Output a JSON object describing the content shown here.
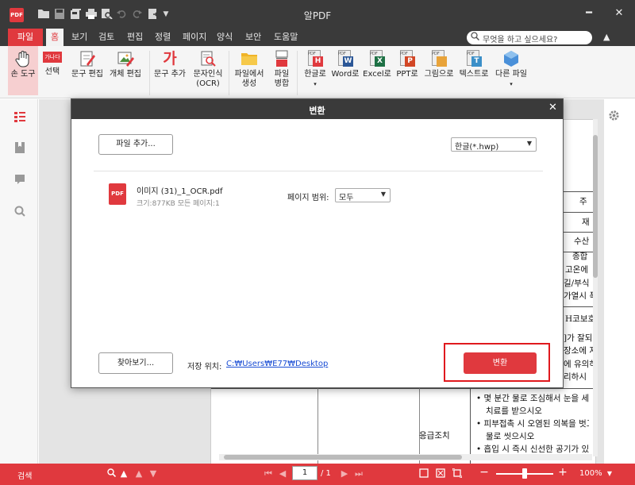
{
  "window": {
    "title": "알PDF",
    "app_logo": "PDF",
    "close": "✕",
    "minimize": "━"
  },
  "quick_access": [
    "folder-icon",
    "save-icon",
    "save-all-icon",
    "print-icon",
    "preview-icon",
    "undo-icon",
    "redo-icon",
    "export-icon",
    "dropdown-icon"
  ],
  "menu": {
    "file": "파일",
    "items": [
      "홈",
      "보기",
      "검토",
      "편집",
      "정렬",
      "페이지",
      "양식",
      "보안",
      "도움말"
    ],
    "active_index": 0,
    "search_placeholder": "무엇을 하고 싶으세요?",
    "collapse": "▲"
  },
  "ribbon": {
    "hand_tool": "손 도구",
    "select": "선택",
    "select_icon_text": "가나다",
    "edit_text": "문구 편집",
    "edit_object": "개체 편집",
    "add_text": "문구 추가",
    "add_text_icon": "가",
    "ocr_line1": "문자인식",
    "ocr_line2": "(OCR)",
    "from_file_line1": "파일에서",
    "from_file_line2": "생성",
    "merge_line1": "파일",
    "merge_line2": "병합",
    "to_hangul": "한글로",
    "to_hangul_icon": "H",
    "to_word": "Word로",
    "to_word_icon": "W",
    "to_excel": "Excel로",
    "to_excel_icon": "X",
    "to_ppt": "PPT로",
    "to_ppt_icon": "P",
    "to_image": "그림으로",
    "to_text": "텍스트로",
    "to_text_icon": "T",
    "to_other": "다른 파일",
    "pdf_badge": "PDF"
  },
  "document_bg": {
    "lines": [
      "주",
      "재",
      "수산",
      "종합",
      "고온에",
      "길/부식",
      "가열시 폭",
      "H코보호",
      "]가 잘되",
      "장소에 저",
      "에 유의하",
      "리하시",
      "응급조치",
      "• 몇 분간 물로 조심해서 눈을 세",
      "치료를 받으시오",
      "• 피부접촉 시 오염된 의복을 벗고",
      "물로 씻으시오",
      "• 흡입 시 즉시 신선한 공기가 있"
    ]
  },
  "dialog": {
    "title": "변환",
    "close": "✕",
    "add_file_button": "파일 추가...",
    "format_select": "한글(*.hwp)",
    "file": {
      "icon_text": "PDF",
      "name": "이미지 (31)_1_OCR.pdf",
      "meta": "크기:877KB   모든 페이지:1"
    },
    "page_range_label": "페이지 범위:",
    "page_range_value": "모두",
    "browse_button": "찾아보기...",
    "save_location_label": "저장 위치:",
    "save_location_path": "C:₩Users₩E77₩Desktop",
    "convert_button": "변환"
  },
  "statusbar": {
    "search": "검색",
    "page_current": "1",
    "page_total": "/ 1",
    "zoom": "100%",
    "zoom_level": 0.5
  },
  "colors": {
    "accent": "#e0393e",
    "titlebar": "#3a3a3a",
    "highlight_box": "#e0191e",
    "link": "#1a4dd4"
  }
}
